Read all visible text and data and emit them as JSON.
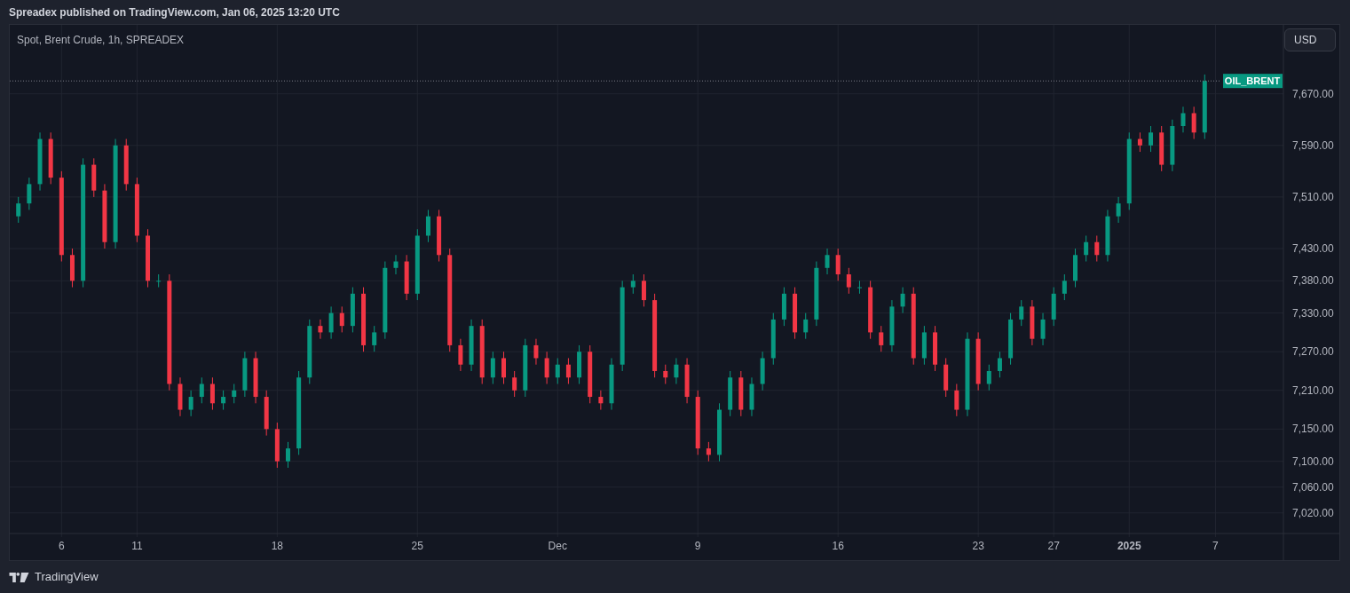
{
  "header": {
    "title": "Spreadex published on TradingView.com, Jan 06, 2025 13:20 UTC"
  },
  "chart": {
    "currency_button": "USD",
    "chart_data": {
      "type": "candlestick",
      "title": "Spot, Brent Crude, 1h, SPREADEX",
      "grid": true,
      "categories": [
        null,
        null,
        null,
        null,
        "6",
        null,
        null,
        null,
        null,
        null,
        null,
        "11",
        null,
        null,
        null,
        null,
        null,
        null,
        null,
        null,
        null,
        null,
        null,
        null,
        "18",
        null,
        null,
        null,
        null,
        null,
        null,
        null,
        null,
        null,
        null,
        null,
        null,
        "25",
        null,
        null,
        null,
        null,
        null,
        null,
        null,
        null,
        null,
        null,
        null,
        null,
        "Dec",
        null,
        null,
        null,
        null,
        null,
        null,
        null,
        null,
        null,
        null,
        null,
        null,
        "9",
        null,
        null,
        null,
        null,
        null,
        null,
        null,
        null,
        null,
        null,
        null,
        null,
        "16",
        null,
        null,
        null,
        null,
        null,
        null,
        null,
        null,
        null,
        null,
        null,
        null,
        "23",
        null,
        null,
        null,
        null,
        null,
        null,
        "27",
        null,
        null,
        null,
        null,
        null,
        null,
        "2025",
        null,
        null,
        null,
        null,
        null,
        null,
        null,
        "7",
        null,
        null,
        null,
        null,
        null,
        null
      ],
      "ohlc": [
        [
          7480,
          7510,
          7470,
          7500
        ],
        [
          7500,
          7540,
          7490,
          7530
        ],
        [
          7530,
          7610,
          7520,
          7600
        ],
        [
          7600,
          7610,
          7530,
          7540
        ],
        [
          7540,
          7550,
          7410,
          7420
        ],
        [
          7420,
          7430,
          7370,
          7380
        ],
        [
          7380,
          7570,
          7370,
          7560
        ],
        [
          7560,
          7570,
          7510,
          7520
        ],
        [
          7520,
          7530,
          7430,
          7440
        ],
        [
          7440,
          7600,
          7430,
          7590
        ],
        [
          7590,
          7600,
          7520,
          7530
        ],
        [
          7530,
          7540,
          7440,
          7450
        ],
        [
          7450,
          7460,
          7370,
          7380
        ],
        [
          7380,
          7390,
          7370,
          7380
        ],
        [
          7380,
          7390,
          7210,
          7220
        ],
        [
          7220,
          7230,
          7170,
          7180
        ],
        [
          7180,
          7210,
          7170,
          7200
        ],
        [
          7200,
          7230,
          7190,
          7220
        ],
        [
          7220,
          7230,
          7180,
          7190
        ],
        [
          7190,
          7210,
          7180,
          7200
        ],
        [
          7200,
          7220,
          7190,
          7210
        ],
        [
          7210,
          7270,
          7200,
          7260
        ],
        [
          7260,
          7270,
          7190,
          7200
        ],
        [
          7200,
          7210,
          7140,
          7150
        ],
        [
          7150,
          7160,
          7090,
          7100
        ],
        [
          7100,
          7130,
          7090,
          7120
        ],
        [
          7120,
          7240,
          7110,
          7230
        ],
        [
          7230,
          7320,
          7220,
          7310
        ],
        [
          7310,
          7320,
          7290,
          7300
        ],
        [
          7300,
          7340,
          7290,
          7330
        ],
        [
          7330,
          7340,
          7300,
          7310
        ],
        [
          7310,
          7370,
          7300,
          7360
        ],
        [
          7360,
          7370,
          7270,
          7280
        ],
        [
          7280,
          7310,
          7270,
          7300
        ],
        [
          7300,
          7410,
          7290,
          7400
        ],
        [
          7400,
          7420,
          7390,
          7410
        ],
        [
          7410,
          7420,
          7350,
          7360
        ],
        [
          7360,
          7460,
          7350,
          7450
        ],
        [
          7450,
          7490,
          7440,
          7480
        ],
        [
          7480,
          7490,
          7410,
          7420
        ],
        [
          7420,
          7430,
          7270,
          7280
        ],
        [
          7280,
          7290,
          7240,
          7250
        ],
        [
          7250,
          7320,
          7240,
          7310
        ],
        [
          7310,
          7320,
          7220,
          7230
        ],
        [
          7230,
          7270,
          7220,
          7260
        ],
        [
          7260,
          7270,
          7220,
          7230
        ],
        [
          7230,
          7240,
          7200,
          7210
        ],
        [
          7210,
          7290,
          7200,
          7280
        ],
        [
          7280,
          7290,
          7250,
          7260
        ],
        [
          7260,
          7270,
          7220,
          7230
        ],
        [
          7230,
          7260,
          7220,
          7250
        ],
        [
          7250,
          7260,
          7220,
          7230
        ],
        [
          7230,
          7280,
          7220,
          7270
        ],
        [
          7270,
          7280,
          7190,
          7200
        ],
        [
          7200,
          7210,
          7180,
          7190
        ],
        [
          7190,
          7260,
          7180,
          7250
        ],
        [
          7250,
          7380,
          7240,
          7370
        ],
        [
          7370,
          7390,
          7360,
          7380
        ],
        [
          7380,
          7390,
          7340,
          7350
        ],
        [
          7350,
          7360,
          7230,
          7240
        ],
        [
          7240,
          7250,
          7220,
          7230
        ],
        [
          7230,
          7260,
          7220,
          7250
        ],
        [
          7250,
          7260,
          7190,
          7200
        ],
        [
          7200,
          7210,
          7110,
          7120
        ],
        [
          7120,
          7130,
          7100,
          7110
        ],
        [
          7110,
          7190,
          7100,
          7180
        ],
        [
          7180,
          7240,
          7170,
          7230
        ],
        [
          7230,
          7240,
          7170,
          7180
        ],
        [
          7180,
          7230,
          7170,
          7220
        ],
        [
          7220,
          7270,
          7210,
          7260
        ],
        [
          7260,
          7330,
          7250,
          7320
        ],
        [
          7320,
          7370,
          7310,
          7360
        ],
        [
          7360,
          7370,
          7290,
          7300
        ],
        [
          7300,
          7330,
          7290,
          7320
        ],
        [
          7320,
          7410,
          7310,
          7400
        ],
        [
          7400,
          7430,
          7390,
          7420
        ],
        [
          7420,
          7430,
          7380,
          7390
        ],
        [
          7390,
          7400,
          7360,
          7370
        ],
        [
          7370,
          7380,
          7360,
          7370
        ],
        [
          7370,
          7380,
          7290,
          7300
        ],
        [
          7300,
          7310,
          7270,
          7280
        ],
        [
          7280,
          7350,
          7270,
          7340
        ],
        [
          7340,
          7370,
          7330,
          7360
        ],
        [
          7360,
          7370,
          7250,
          7260
        ],
        [
          7260,
          7310,
          7250,
          7300
        ],
        [
          7300,
          7310,
          7240,
          7250
        ],
        [
          7250,
          7260,
          7200,
          7210
        ],
        [
          7210,
          7220,
          7170,
          7180
        ],
        [
          7180,
          7300,
          7170,
          7290
        ],
        [
          7290,
          7300,
          7210,
          7220
        ],
        [
          7220,
          7250,
          7210,
          7240
        ],
        [
          7240,
          7270,
          7230,
          7260
        ],
        [
          7260,
          7330,
          7250,
          7320
        ],
        [
          7320,
          7350,
          7310,
          7340
        ],
        [
          7340,
          7350,
          7280,
          7290
        ],
        [
          7290,
          7330,
          7280,
          7320
        ],
        [
          7320,
          7370,
          7310,
          7360
        ],
        [
          7360,
          7390,
          7350,
          7380
        ],
        [
          7380,
          7430,
          7370,
          7420
        ],
        [
          7420,
          7450,
          7410,
          7440
        ],
        [
          7440,
          7450,
          7410,
          7420
        ],
        [
          7420,
          7490,
          7410,
          7480
        ],
        [
          7480,
          7510,
          7470,
          7500
        ],
        [
          7500,
          7610,
          7490,
          7600
        ],
        [
          7600,
          7610,
          7580,
          7590
        ],
        [
          7590,
          7620,
          7580,
          7610
        ],
        [
          7610,
          7620,
          7550,
          7560
        ],
        [
          7560,
          7630,
          7550,
          7620
        ],
        [
          7620,
          7650,
          7610,
          7640
        ],
        [
          7640,
          7650,
          7600,
          7610
        ],
        [
          7610,
          7700,
          7600,
          7690
        ],
        null,
        null,
        null,
        null,
        null,
        null,
        null
      ],
      "ylim": [
        6988,
        7777
      ],
      "yticks": [
        {
          "value": 7020,
          "label": "7,020.00"
        },
        {
          "value": 7060,
          "label": "7,060.00"
        },
        {
          "value": 7100,
          "label": "7,100.00"
        },
        {
          "value": 7150,
          "label": "7,150.00"
        },
        {
          "value": 7210,
          "label": "7,210.00"
        },
        {
          "value": 7270,
          "label": "7,270.00"
        },
        {
          "value": 7330,
          "label": "7,330.00"
        },
        {
          "value": 7380,
          "label": "7,380.00"
        },
        {
          "value": 7430,
          "label": "7,430.00"
        },
        {
          "value": 7510,
          "label": "7,510.00"
        },
        {
          "value": 7590,
          "label": "7,590.00"
        },
        {
          "value": 7670,
          "label": "7,670.00"
        }
      ],
      "ref_lines": [
        {
          "axis": "y",
          "value": 7690,
          "label": "OIL_BRENT"
        }
      ]
    }
  },
  "footer": {
    "brand": "TradingView"
  }
}
